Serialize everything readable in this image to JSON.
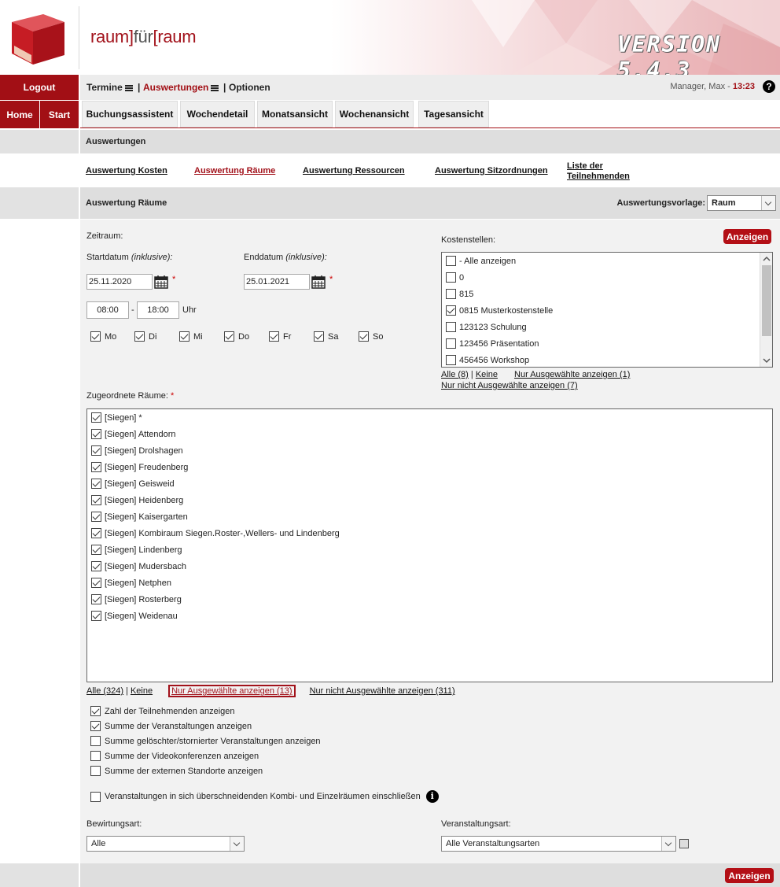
{
  "header": {
    "brand_left": "raum]",
    "brand_mid": "für",
    "brand_right": "[raum",
    "version": "VERSION 5.4.3"
  },
  "nav": {
    "logout": "Logout",
    "home": "Home",
    "start": "Start"
  },
  "menu": {
    "termine": "Termine",
    "sep1": "|",
    "auswertungen": "Auswertungen",
    "sep2": "|",
    "optionen": "Optionen",
    "user": "Manager, Max - ",
    "time": "13:23",
    "help": "?"
  },
  "tabs": [
    "Buchungsassistent",
    "Wochendetail",
    "Monatsansicht",
    "Wochenansicht",
    "Tagesansicht"
  ],
  "section": {
    "title": "Auswertungen",
    "links": [
      "Auswertung Kosten",
      "Auswertung Räume",
      "Auswertung Ressourcen",
      "Auswertung Sitzordnungen"
    ],
    "link_last_1": "Liste der",
    "link_last_2": "Teilnehmenden"
  },
  "panel": {
    "title": "Auswertung Räume",
    "vorlage_label": "Auswertungsvorlage:",
    "vorlage_value": "Raum"
  },
  "zeitraum": {
    "label": "Zeitraum:",
    "start_label": "Startdatum",
    "inklusive": "(inklusive):",
    "end_label": "Enddatum",
    "start_value": "25.11.2020",
    "end_value": "25.01.2021",
    "time_from": "08:00",
    "dash": "-",
    "time_to": "18:00",
    "uhr": "Uhr",
    "asterisk": "*",
    "days": [
      {
        "label": "Mo",
        "checked": true
      },
      {
        "label": "Di",
        "checked": true
      },
      {
        "label": "Mi",
        "checked": true
      },
      {
        "label": "Do",
        "checked": true
      },
      {
        "label": "Fr",
        "checked": true
      },
      {
        "label": "Sa",
        "checked": true
      },
      {
        "label": "So",
        "checked": true
      }
    ]
  },
  "kostenstellen": {
    "label": "Kostenstellen:",
    "button": "Anzeigen",
    "items": [
      {
        "label": "- Alle anzeigen",
        "checked": false
      },
      {
        "label": "0",
        "checked": false
      },
      {
        "label": "815",
        "checked": false
      },
      {
        "label": "0815 Musterkostenstelle",
        "checked": true
      },
      {
        "label": "123123 Schulung",
        "checked": false
      },
      {
        "label": "123456 Präsentation",
        "checked": false
      },
      {
        "label": "456456 Workshop",
        "checked": false
      }
    ],
    "all": "Alle (8)",
    "sep": "|",
    "none": "Keine",
    "only_selected": "Nur Ausgewählte anzeigen (1)",
    "only_unselected": "Nur nicht Ausgewählte anzeigen (7)"
  },
  "raeume": {
    "label": "Zugeordnete Räume:",
    "asterisk": "*",
    "items": [
      "[Siegen] *",
      "[Siegen] Attendorn",
      "[Siegen] Drolshagen",
      "[Siegen] Freudenberg",
      "[Siegen] Geisweid",
      "[Siegen] Heidenberg",
      "[Siegen] Kaisergarten",
      "[Siegen] Kombiraum Siegen.Roster-,Wellers- und Lindenberg",
      "[Siegen] Lindenberg",
      "[Siegen] Mudersbach",
      "[Siegen] Netphen",
      "[Siegen] Rosterberg",
      "[Siegen] Weidenau"
    ],
    "all": "Alle (324)",
    "sep": "|",
    "none": "Keine",
    "only_selected": "Nur Ausgewählte anzeigen (13)",
    "only_unselected": "Nur nicht Ausgewählte anzeigen (311)"
  },
  "options": [
    {
      "label": "Zahl der Teilnehmenden anzeigen",
      "checked": true
    },
    {
      "label": "Summe der Veranstaltungen anzeigen",
      "checked": true
    },
    {
      "label": "Summe gelöschter/stornierter Veranstaltungen anzeigen",
      "checked": false
    },
    {
      "label": "Summe der Videokonferenzen anzeigen",
      "checked": false
    },
    {
      "label": "Summe der externen Standorte anzeigen",
      "checked": false
    }
  ],
  "kombi_option": {
    "label": "Veranstaltungen in sich überschneidenden Kombi- und Einzelräumen einschließen",
    "checked": false
  },
  "bewirtung": {
    "label": "Bewirtungsart:",
    "value": "Alle"
  },
  "veranstaltung": {
    "label": "Veranstaltungsart:",
    "value": "Alle Veranstaltungsarten"
  },
  "footer": {
    "button": "Anzeigen"
  },
  "colors": {
    "accent": "#a20f15",
    "panel": "#f2f2f2",
    "head": "#dedede"
  }
}
